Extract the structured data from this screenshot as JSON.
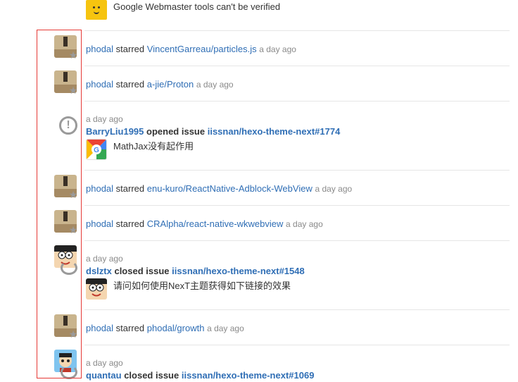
{
  "feed": {
    "top_item": {
      "text": "Google Webmaster tools can't be verified",
      "icon": "emoji-face-icon"
    },
    "items": [
      {
        "type": "star",
        "user": "phodal",
        "action": "starred",
        "repo": "VincentGarreau/particles.js",
        "time": "a day ago"
      },
      {
        "type": "star",
        "user": "phodal",
        "action": "starred",
        "repo": "a-jie/Proton",
        "time": "a day ago"
      },
      {
        "type": "issue",
        "time": "a day ago",
        "user": "BarryLiu1995",
        "action": "opened issue",
        "target": "iissnan/hexo-theme-next#1774",
        "detail": "MathJax没有起作用"
      },
      {
        "type": "star",
        "user": "phodal",
        "action": "starred",
        "repo": "enu-kuro/ReactNative-Adblock-WebView",
        "time": "a day ago"
      },
      {
        "type": "star",
        "user": "phodal",
        "action": "starred",
        "repo": "CRAlpha/react-native-wkwebview",
        "time": "a day ago"
      },
      {
        "type": "issue",
        "time": "a day ago",
        "user": "dslztx",
        "action": "closed issue",
        "target": "iissnan/hexo-theme-next#1548",
        "detail": "请问如何使用NexT主题获得如下链接的效果"
      },
      {
        "type": "star",
        "user": "phodal",
        "action": "starred",
        "repo": "phodal/growth",
        "time": "a day ago"
      },
      {
        "type": "issue",
        "time": "a day ago",
        "user": "quantau",
        "action": "closed issue",
        "target": "iissnan/hexo-theme-next#1069"
      }
    ]
  },
  "colors": {
    "link": "#2f6eb5",
    "highlight": "#e53935",
    "divider": "#e6e6e6"
  }
}
